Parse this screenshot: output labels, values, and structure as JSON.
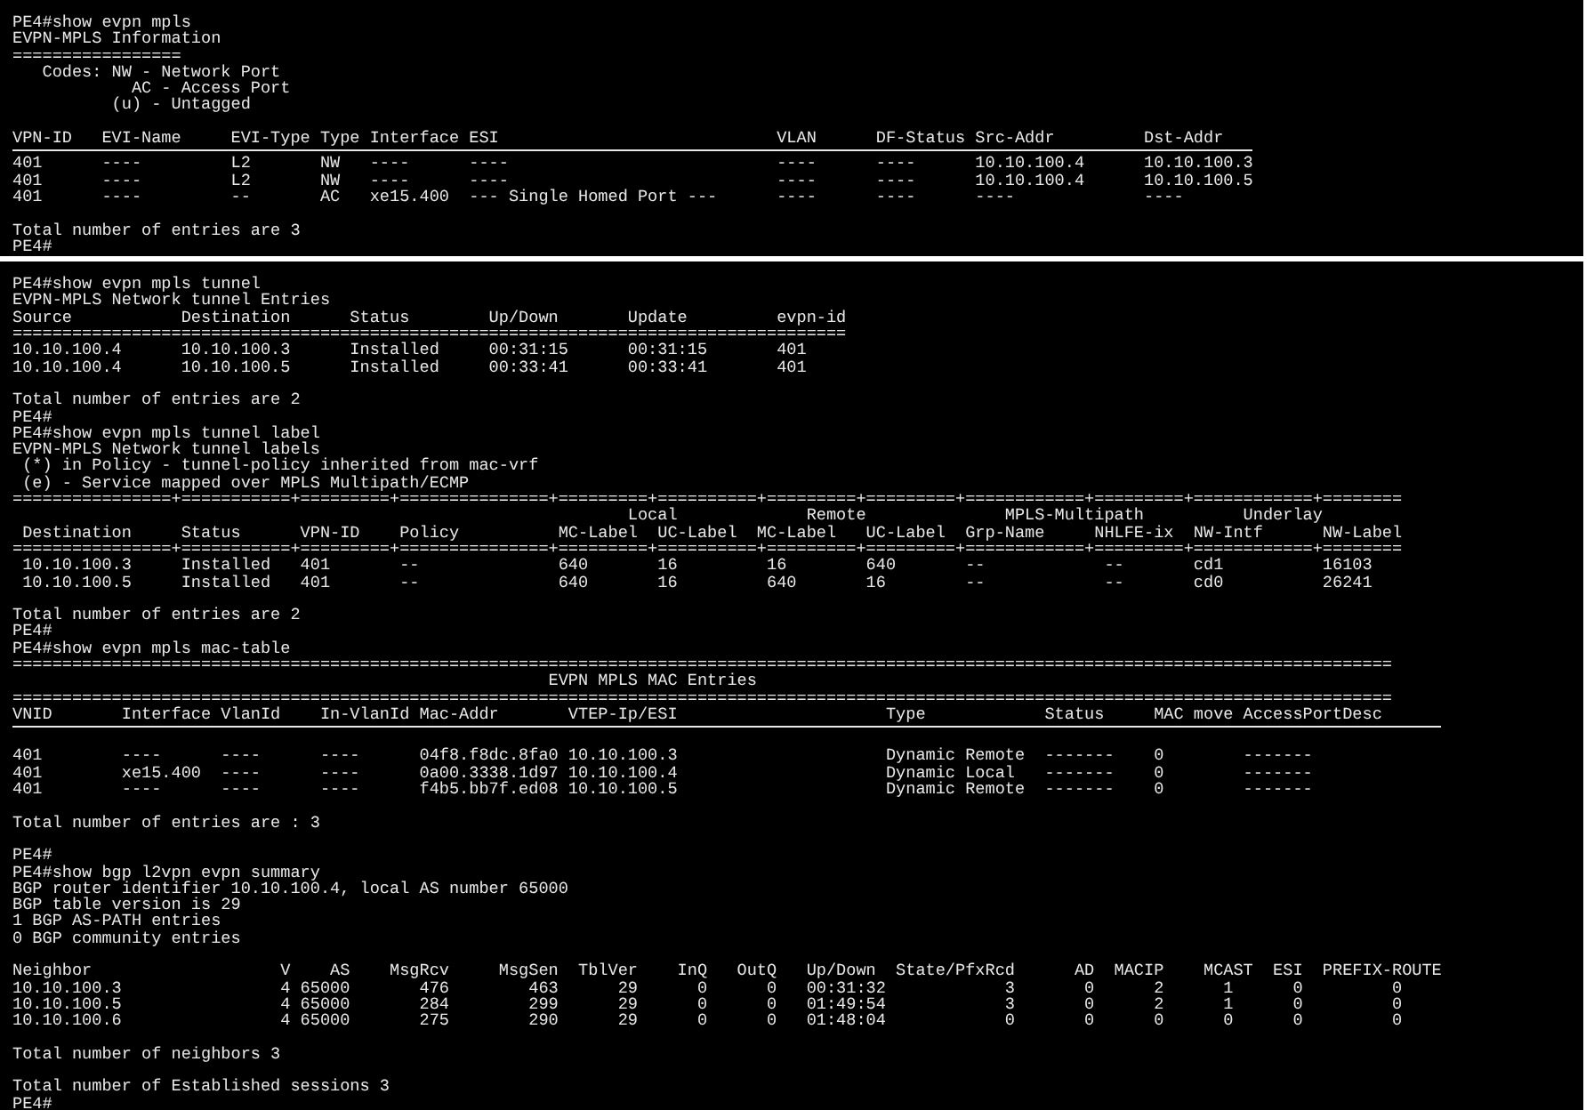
{
  "panels": [
    {
      "lines": [
        {
          "kind": "text",
          "text": "PE4#show evpn mpls"
        },
        {
          "kind": "text",
          "text": "EVPN-MPLS Information"
        },
        {
          "kind": "text",
          "text": "================="
        },
        {
          "kind": "text",
          "text": "   Codes: NW - Network Port"
        },
        {
          "kind": "text",
          "text": "            AC - Access Port"
        },
        {
          "kind": "text",
          "text": "          (u) - Untagged"
        },
        {
          "kind": "blank"
        },
        {
          "kind": "text",
          "text": "VPN-ID   EVI-Name     EVI-Type Type Interface ESI                            VLAN      DF-Status Src-Addr         Dst-Addr"
        },
        {
          "kind": "rule"
        },
        {
          "kind": "text",
          "text": "401      ----         L2       NW   ----      ----                           ----      ----      10.10.100.4      10.10.100.3"
        },
        {
          "kind": "text",
          "text": "401      ----         L2       NW   ----      ----                           ----      ----      10.10.100.4      10.10.100.5"
        },
        {
          "kind": "text",
          "text": "401      ----         --       AC   xe15.400  --- Single Homed Port ---      ----      ----      ----             ----"
        },
        {
          "kind": "blank"
        },
        {
          "kind": "text",
          "text": "Total number of entries are 3"
        },
        {
          "kind": "text",
          "text": "PE4#"
        }
      ]
    },
    {
      "lines": [
        {
          "kind": "text",
          "text": "PE4#show evpn mpls tunnel"
        },
        {
          "kind": "text",
          "text": "EVPN-MPLS Network tunnel Entries"
        },
        {
          "kind": "text",
          "text": "Source           Destination      Status        Up/Down       Update         evpn-id"
        },
        {
          "kind": "text",
          "text": "===================================================================================="
        },
        {
          "kind": "text",
          "text": "10.10.100.4      10.10.100.3      Installed     00:31:15      00:31:15       401"
        },
        {
          "kind": "text",
          "text": "10.10.100.4      10.10.100.5      Installed     00:33:41      00:33:41       401"
        },
        {
          "kind": "blank"
        },
        {
          "kind": "text",
          "text": "Total number of entries are 2"
        },
        {
          "kind": "text",
          "text": "PE4#"
        },
        {
          "kind": "text",
          "text": "PE4#show evpn mpls tunnel label"
        },
        {
          "kind": "text",
          "text": "EVPN-MPLS Network tunnel labels"
        },
        {
          "kind": "text",
          "text": " (*) in Policy - tunnel-policy inherited from mac-vrf"
        },
        {
          "kind": "text",
          "text": " (e) - Service mapped over MPLS Multipath/ECMP"
        },
        {
          "kind": "text",
          "text": "================+===========+=========+===============+=========+==========+=========+=========+============+=========+============+========"
        },
        {
          "kind": "text",
          "text": "                                                              Local             Remote              MPLS-Multipath          Underlay"
        },
        {
          "kind": "text",
          "text": " Destination     Status      VPN-ID    Policy          MC-Label  UC-Label  MC-Label   UC-Label  Grp-Name     NHLFE-ix  NW-Intf      NW-Label"
        },
        {
          "kind": "text",
          "text": "================+===========+=========+===============+=========+==========+=========+=========+============+=========+============+========"
        },
        {
          "kind": "text",
          "text": " 10.10.100.3     Installed   401       --              640       16         16        640       --            --       cd1          16103"
        },
        {
          "kind": "text",
          "text": " 10.10.100.5     Installed   401       --              640       16         640       16        --            --       cd0          26241"
        },
        {
          "kind": "blank"
        },
        {
          "kind": "text",
          "text": "Total number of entries are 2"
        },
        {
          "kind": "text",
          "text": "PE4#"
        },
        {
          "kind": "text",
          "text": "PE4#show evpn mpls mac-table"
        },
        {
          "kind": "text",
          "text": "==========================================================================================================================================="
        },
        {
          "kind": "text",
          "text": "                                                      EVPN MPLS MAC Entries"
        },
        {
          "kind": "text",
          "text": "==========================================================================================================================================="
        },
        {
          "kind": "text",
          "text": "VNID       Interface VlanId    In-VlanId Mac-Addr       VTEP-Ip/ESI                     Type            Status     MAC move AccessPortDesc"
        },
        {
          "kind": "rule"
        },
        {
          "kind": "blank"
        },
        {
          "kind": "text",
          "text": "401        ----      ----      ----      04f8.f8dc.8fa0 10.10.100.3                     Dynamic Remote  -------    0        -------"
        },
        {
          "kind": "text",
          "text": "401        xe15.400  ----      ----      0a00.3338.1d97 10.10.100.4                     Dynamic Local   -------    0        -------"
        },
        {
          "kind": "text",
          "text": "401        ----      ----      ----      f4b5.bb7f.ed08 10.10.100.5                     Dynamic Remote  -------    0        -------"
        },
        {
          "kind": "blank"
        },
        {
          "kind": "text",
          "text": "Total number of entries are : 3"
        },
        {
          "kind": "blank"
        },
        {
          "kind": "text",
          "text": "PE4#"
        },
        {
          "kind": "text",
          "text": "PE4#show bgp l2vpn evpn summary"
        },
        {
          "kind": "text",
          "text": "BGP router identifier 10.10.100.4, local AS number 65000"
        },
        {
          "kind": "text",
          "text": "BGP table version is 29"
        },
        {
          "kind": "text",
          "text": "1 BGP AS-PATH entries"
        },
        {
          "kind": "text",
          "text": "0 BGP community entries"
        },
        {
          "kind": "blank"
        },
        {
          "kind": "text",
          "text": "Neighbor                   V    AS    MsgRcv     MsgSen  TblVer    InQ   OutQ   Up/Down  State/PfxRcd      AD  MACIP    MCAST  ESI  PREFIX-ROUTE"
        },
        {
          "kind": "text",
          "text": "10.10.100.3                4 65000       476        463      29      0      0   00:31:32            3       0      2      1      0         0"
        },
        {
          "kind": "text",
          "text": "10.10.100.5                4 65000       284        299      29      0      0   01:49:54            3       0      2      1      0         0"
        },
        {
          "kind": "text",
          "text": "10.10.100.6                4 65000       275        290      29      0      0   01:48:04            0       0      0      0      0         0"
        },
        {
          "kind": "blank"
        },
        {
          "kind": "text",
          "text": "Total number of neighbors 3"
        },
        {
          "kind": "blank"
        },
        {
          "kind": "text",
          "text": "Total number of Established sessions 3"
        },
        {
          "kind": "text",
          "text": "PE4#"
        }
      ]
    }
  ]
}
